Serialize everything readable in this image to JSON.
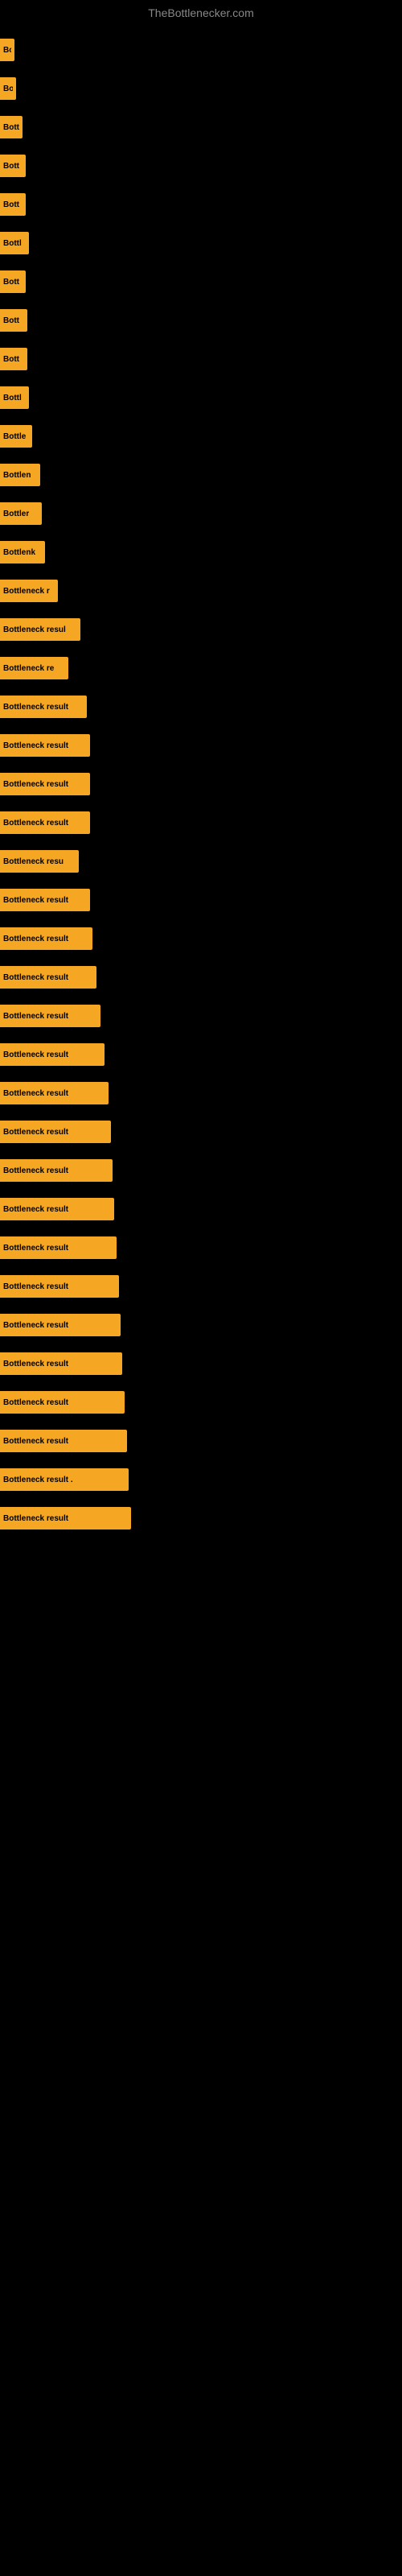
{
  "site_title": "TheBottlenecker.com",
  "items": [
    {
      "label": "Bo",
      "width": 18
    },
    {
      "label": "Bo",
      "width": 20
    },
    {
      "label": "Bott",
      "width": 28
    },
    {
      "label": "Bott",
      "width": 32
    },
    {
      "label": "Bott",
      "width": 32
    },
    {
      "label": "Bottl",
      "width": 36
    },
    {
      "label": "Bott",
      "width": 32
    },
    {
      "label": "Bott",
      "width": 34
    },
    {
      "label": "Bott",
      "width": 34
    },
    {
      "label": "Bottl",
      "width": 36
    },
    {
      "label": "Bottle",
      "width": 40
    },
    {
      "label": "Bottlen",
      "width": 50
    },
    {
      "label": "Bottler",
      "width": 52
    },
    {
      "label": "Bottlenk",
      "width": 56
    },
    {
      "label": "Bottleneck r",
      "width": 72
    },
    {
      "label": "Bottleneck resul",
      "width": 100
    },
    {
      "label": "Bottleneck re",
      "width": 85
    },
    {
      "label": "Bottleneck result",
      "width": 108
    },
    {
      "label": "Bottleneck result",
      "width": 112
    },
    {
      "label": "Bottleneck result",
      "width": 112
    },
    {
      "label": "Bottleneck result",
      "width": 112
    },
    {
      "label": "Bottleneck resu",
      "width": 98
    },
    {
      "label": "Bottleneck result",
      "width": 112
    },
    {
      "label": "Bottleneck result",
      "width": 115
    },
    {
      "label": "Bottleneck result",
      "width": 120
    },
    {
      "label": "Bottleneck result",
      "width": 125
    },
    {
      "label": "Bottleneck result",
      "width": 130
    },
    {
      "label": "Bottleneck result",
      "width": 135
    },
    {
      "label": "Bottleneck result",
      "width": 138
    },
    {
      "label": "Bottleneck result",
      "width": 140
    },
    {
      "label": "Bottleneck result",
      "width": 142
    },
    {
      "label": "Bottleneck result",
      "width": 145
    },
    {
      "label": "Bottleneck result",
      "width": 148
    },
    {
      "label": "Bottleneck result",
      "width": 150
    },
    {
      "label": "Bottleneck result",
      "width": 152
    },
    {
      "label": "Bottleneck result",
      "width": 155
    },
    {
      "label": "Bottleneck result",
      "width": 158
    },
    {
      "label": "Bottleneck result .",
      "width": 160
    },
    {
      "label": "Bottleneck result",
      "width": 163
    }
  ],
  "colors": {
    "bar": "#f5a623",
    "background": "#000000",
    "title": "#888888"
  }
}
